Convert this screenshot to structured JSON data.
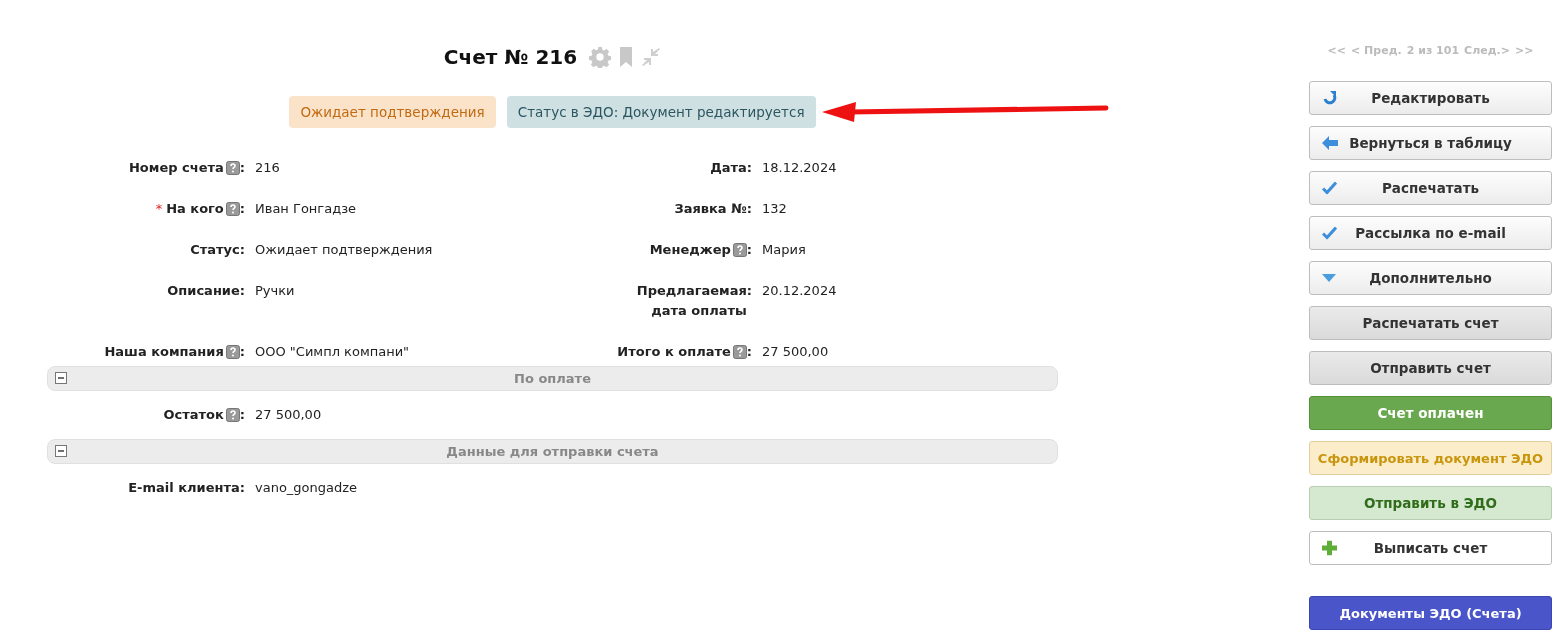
{
  "title": "Счет № 216",
  "badges": [
    {
      "text": "Ожидает подтверждения",
      "kind": "status"
    },
    {
      "text": "Статус в ЭДО: Документ редактируется",
      "kind": "edo"
    }
  ],
  "fields": [
    {
      "left": {
        "label": "Номер счета",
        "help": true,
        "colon": ":",
        "value": "216"
      },
      "right": {
        "label": "Дата",
        "help": false,
        "colon": ":",
        "value": "18.12.2024"
      }
    },
    {
      "left": {
        "required_mark": "*",
        "label": "На кого",
        "help": true,
        "colon": ":",
        "value": "Иван Гонгадзе"
      },
      "right": {
        "label": "Заявка №",
        "help": false,
        "colon": ":",
        "value": "132"
      }
    },
    {
      "left": {
        "label": "Статус",
        "help": false,
        "colon": ":",
        "value": "Ожидает подтверждения"
      },
      "right": {
        "label": "Менеджер",
        "help": true,
        "colon": ":",
        "value": "Мария"
      }
    },
    {
      "left": {
        "label": "Описание",
        "help": false,
        "colon": ":",
        "value": "Ручки"
      },
      "right": {
        "label": "Предлагаемая дата оплаты",
        "help": false,
        "colon": ":",
        "value": "20.12.2024"
      }
    },
    {
      "left": {
        "label": "Наша компания",
        "help": true,
        "colon": ":",
        "value": "ООО \"Симпл компани\""
      },
      "right": {
        "label": "Итого к оплате",
        "help": true,
        "colon": ":",
        "value": "27 500,00"
      }
    }
  ],
  "sections": [
    {
      "title": "По оплате",
      "expanded": true,
      "fields": [
        {
          "label": "Остаток",
          "help": true,
          "colon": ":",
          "value": "27 500,00"
        }
      ]
    },
    {
      "title": "Данные для отправки счета",
      "expanded": true,
      "fields": [
        {
          "label": "E-mail клиента",
          "help": false,
          "colon": ":",
          "value": "vano_gongadze"
        }
      ]
    }
  ],
  "pager": {
    "first": "<<",
    "prev": "< Пред.",
    "position": "2 из 101",
    "next": "След.>",
    "last": ">>"
  },
  "buttons": [
    {
      "label": "Редактировать",
      "kind": "edit"
    },
    {
      "label": "Вернуться в таблицу",
      "kind": "return"
    },
    {
      "label": "Распечатать",
      "kind": "check"
    },
    {
      "label": "Рассылка по e-mail",
      "kind": "check"
    },
    {
      "label": "Дополнительно",
      "kind": "more"
    },
    {
      "label": "Распечатать счет",
      "kind": "gray"
    },
    {
      "label": "Отправить счет",
      "kind": "gray"
    },
    {
      "label": "Счет оплачен",
      "kind": "green"
    },
    {
      "label": "Сформировать документ ЭДО",
      "kind": "yellow"
    },
    {
      "label": "Отправить в ЭДО",
      "kind": "lightgreen"
    },
    {
      "label": "Выписать счет",
      "kind": "add"
    },
    {
      "label": "Документы ЭДО (Счета)",
      "kind": "blue"
    }
  ]
}
